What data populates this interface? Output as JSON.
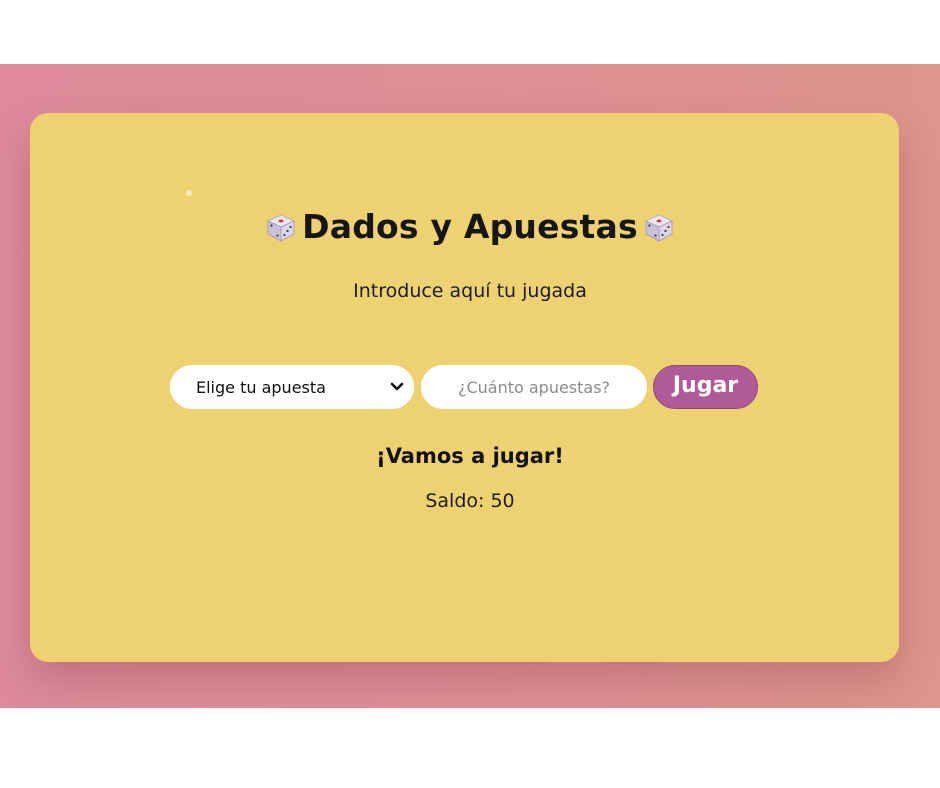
{
  "game": {
    "title": "Dados y Apuestas",
    "subtitle": "Introduce aquí tu jugada",
    "bet_select": {
      "selected_label": "Elige tu apuesta"
    },
    "amount_input": {
      "placeholder": "¿Cuánto apuestas?",
      "value": ""
    },
    "play_button_label": "Jugar",
    "status_message": "¡Vamos a jugar!",
    "balance_text": "Saldo: 50"
  },
  "colors": {
    "background_gradient_start": "#de8a9b",
    "background_gradient_end": "#de958b",
    "card": "#eed272",
    "button": "#b15a9a"
  },
  "icons": {
    "title_left": "dice-icon",
    "title_right": "dice-icon",
    "select_arrow": "chevron-down-icon"
  }
}
